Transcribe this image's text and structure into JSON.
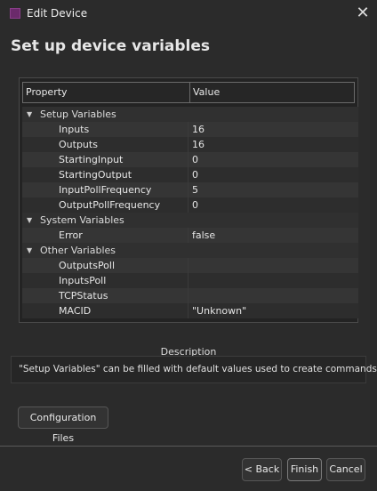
{
  "window": {
    "title": "Edit Device",
    "close_glyph": "✕"
  },
  "page": {
    "title": "Set up device variables"
  },
  "grid": {
    "columns": [
      "Property",
      "Value"
    ],
    "rows": [
      {
        "type": "group",
        "label": "Setup Variables",
        "value": ""
      },
      {
        "type": "prop",
        "label": "Inputs",
        "value": "16"
      },
      {
        "type": "prop",
        "label": "Outputs",
        "value": "16"
      },
      {
        "type": "prop",
        "label": "StartingInput",
        "value": "0"
      },
      {
        "type": "prop",
        "label": "StartingOutput",
        "value": "0"
      },
      {
        "type": "prop",
        "label": "InputPollFrequency",
        "value": "5"
      },
      {
        "type": "prop",
        "label": "OutputPollFrequency",
        "value": "0"
      },
      {
        "type": "group",
        "label": "System Variables",
        "value": ""
      },
      {
        "type": "prop",
        "label": "Error",
        "value": "false"
      },
      {
        "type": "group",
        "label": "Other Variables",
        "value": ""
      },
      {
        "type": "prop",
        "label": "OutputsPoll",
        "value": ""
      },
      {
        "type": "prop",
        "label": "InputsPoll",
        "value": ""
      },
      {
        "type": "prop",
        "label": "TCPStatus",
        "value": ""
      },
      {
        "type": "prop",
        "label": "MACID",
        "value": "\"Unknown\""
      }
    ],
    "group_caret": "▼"
  },
  "description": {
    "label": "Description",
    "text": "\"Setup Variables\" can be filled with default values used to create commands."
  },
  "buttons": {
    "config_files": "Configuration Files",
    "back": "< Back",
    "finish": "Finish",
    "cancel": "Cancel"
  },
  "colors": {
    "background": "#2b2b2b",
    "app_icon": "#6b2a6b"
  }
}
